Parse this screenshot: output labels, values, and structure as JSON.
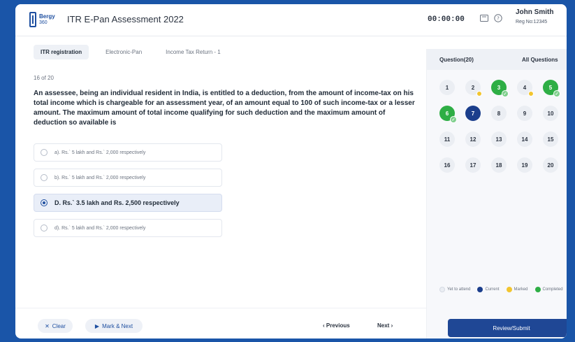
{
  "header": {
    "logo_line1": "Bergy",
    "logo_line2": "360",
    "title": "ITR E-Pan Assessment 2022",
    "timer": "00:00:00",
    "user_name": "John Smith",
    "reg_no": "Reg No:12345"
  },
  "tabs": [
    {
      "label": "ITR registration",
      "active": true
    },
    {
      "label": "Electronic-Pan",
      "active": false
    },
    {
      "label": "Income Tax Return - 1",
      "active": false
    }
  ],
  "question": {
    "count": "16 of 20",
    "text": "An assessee, being an individual resident in India, is entitled to a deduction, from the amount of income-tax on his total income which is chargeable for an assessment year, of an amount equal to 100 of such income-tax or a lesser amount. The maximum amount of total income qualifying for such deduction and the maximum amount of deduction so available is",
    "options": [
      {
        "label": "a). Rs.` 5 lakh and Rs.` 2,000 respectively",
        "selected": false
      },
      {
        "label": "b). Rs.` 5 lakh and Rs.` 2,000 respectively",
        "selected": false
      },
      {
        "label": "D. Rs.` 3.5 lakh and Rs. 2,500 respectively",
        "selected": true
      },
      {
        "label": "d). Rs.` 5 lakh and Rs.` 2,000 respectively",
        "selected": false
      }
    ]
  },
  "footer": {
    "clear": "Clear",
    "mark_next": "Mark & Next",
    "previous": "Previous",
    "next": "Next"
  },
  "sidebar": {
    "questions_label": "Question(20)",
    "all_label": "All Questions",
    "cells": [
      {
        "n": "1",
        "status": "default",
        "marked": false
      },
      {
        "n": "2",
        "status": "default",
        "marked": true
      },
      {
        "n": "3",
        "status": "completed",
        "marked": false
      },
      {
        "n": "4",
        "status": "default",
        "marked": true
      },
      {
        "n": "5",
        "status": "completed",
        "marked": false
      },
      {
        "n": "6",
        "status": "completed",
        "marked": false
      },
      {
        "n": "7",
        "status": "current",
        "marked": false
      },
      {
        "n": "8",
        "status": "default",
        "marked": false
      },
      {
        "n": "9",
        "status": "default",
        "marked": false
      },
      {
        "n": "10",
        "status": "default",
        "marked": false
      },
      {
        "n": "11",
        "status": "default",
        "marked": false
      },
      {
        "n": "12",
        "status": "default",
        "marked": false
      },
      {
        "n": "13",
        "status": "default",
        "marked": false
      },
      {
        "n": "14",
        "status": "default",
        "marked": false
      },
      {
        "n": "15",
        "status": "default",
        "marked": false
      },
      {
        "n": "16",
        "status": "default",
        "marked": false
      },
      {
        "n": "17",
        "status": "default",
        "marked": false
      },
      {
        "n": "18",
        "status": "default",
        "marked": false
      },
      {
        "n": "19",
        "status": "default",
        "marked": false
      },
      {
        "n": "20",
        "status": "default",
        "marked": false
      }
    ],
    "legend": [
      {
        "label": "Yet to attend",
        "color": "#ebeef3"
      },
      {
        "label": "Current",
        "color": "#1b3e8c"
      },
      {
        "label": "Marked",
        "color": "#f2c52f"
      },
      {
        "label": "Completed",
        "color": "#2eae45"
      }
    ],
    "submit": "Review/Submit"
  },
  "colors": {
    "background": "#1a55a8",
    "primary": "#1f4795",
    "completed": "#2eae45",
    "current": "#1b3e8c",
    "marked": "#f2c52f"
  }
}
